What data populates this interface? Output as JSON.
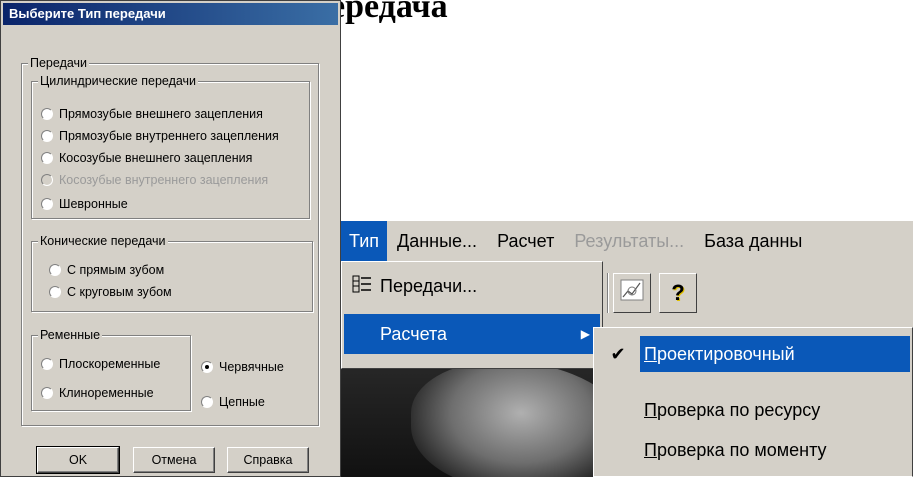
{
  "background_title": "ередача",
  "dialog": {
    "title": "Выберите Тип передачи",
    "group_main": "Передачи",
    "group_cyl": "Цилиндрические передачи",
    "cyl_options": [
      "Прямозубые внешнего зацепления",
      "Прямозубые внутреннего зацепления",
      "Косозубые внешнего зацепления",
      "Косозубые внутреннего зацепления",
      "Шевронные"
    ],
    "group_con": "Конические передачи",
    "con_options": [
      "С прямым зубом",
      "С круговым зубом"
    ],
    "group_belt": "Ременные",
    "belt_options": [
      "Плоскоременные",
      "Клиноременные"
    ],
    "other_options": [
      "Червячные",
      "Цепные"
    ],
    "selected": "Червячные",
    "buttons": {
      "ok": "OK",
      "cancel": "Отмена",
      "help": "Справка"
    }
  },
  "menu": {
    "bar": [
      "Тип",
      "Данные...",
      "Расчет",
      "Результаты...",
      "База данны"
    ],
    "active": "Тип",
    "disabled": [
      "Результаты..."
    ],
    "dropdown": {
      "item1": "Передачи...",
      "item2": "Расчета"
    },
    "submenu": [
      "Проектировочный",
      "Проверка по ресурсу",
      "Проверка по моменту"
    ],
    "submenu_checked": "Проектировочный",
    "toolbar_icons": [
      "graph-icon",
      "help-icon"
    ],
    "help_glyph": "?"
  },
  "colors": {
    "highlight": "#0a58b8",
    "titlebar": "#0a246a",
    "face": "#d4d0c8"
  }
}
